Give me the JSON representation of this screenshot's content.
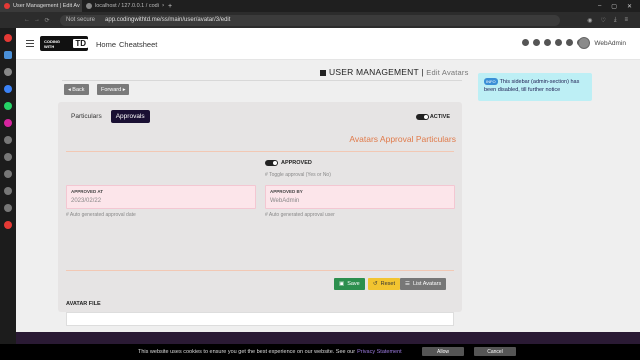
{
  "browser": {
    "tabs": [
      {
        "title": "User Management | Edit Av",
        "active": true
      },
      {
        "title": "localhost / 127.0.0.1 / codi",
        "active": false
      }
    ],
    "new_tab": "+",
    "nav": {
      "back": "←",
      "forward": "→",
      "reload": "⟳"
    },
    "secure_label": "Not secure",
    "url": "app.codingwithtd.me/ss/main/user/avatar/3/edit"
  },
  "header": {
    "logo_text": "CODING WITH",
    "logo_mark": "TD",
    "nav": [
      "Home",
      "Cheatsheet"
    ],
    "user": "WebAdmin"
  },
  "page": {
    "title": "USER MANAGEMENT",
    "title_sep": "|",
    "subtitle": "Edit Avatars",
    "back_label": "Back",
    "forward_label": "Forward"
  },
  "info": {
    "badge": "INFO",
    "text": "This sidebar (admin-section) has been disabled, till further notice"
  },
  "card": {
    "tabs": [
      "Particulars",
      "Approvals"
    ],
    "selected_tab": "Approvals",
    "active_label": "ACTIVE",
    "title": "Avatars Approval Particulars",
    "approved_label": "APPROVED",
    "approved_hint": "# Toggle approval (Yes or No)",
    "approved_at_label": "APPROVED AT",
    "approved_at_value": "2023/02/22",
    "approved_at_hint": "# Auto generated approval date",
    "approved_by_label": "APPROVED BY",
    "approved_by_value": "WebAdmin",
    "approved_by_hint": "# Auto generated approval user",
    "save_label": "Save",
    "reset_label": "Reset",
    "list_label": "List Avatars",
    "avatar_file_label": "AVATAR FILE"
  },
  "cookie": {
    "text": "This website uses cookies to ensure you get the best experience on our website. See our",
    "link": "Privacy Statement",
    "allow": "Allow",
    "cancel": "Cancel"
  },
  "colors": {
    "accent_dark": "#1a1033",
    "title_orange": "#e07a4a",
    "save_green": "#2c8f4e",
    "reset_yellow": "#f2c430",
    "info_bg": "#bdeff5"
  }
}
